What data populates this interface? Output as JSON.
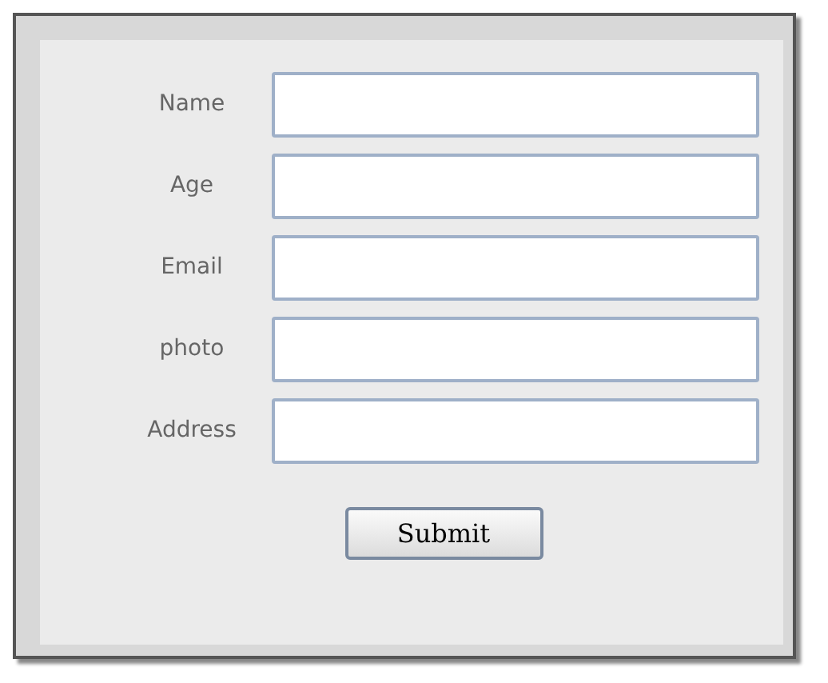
{
  "fields": [
    {
      "label": "Name"
    },
    {
      "label": "Age"
    },
    {
      "label": "Email"
    },
    {
      "label": "photo"
    },
    {
      "label": "Address"
    }
  ],
  "submit": {
    "label": "Submit"
  }
}
